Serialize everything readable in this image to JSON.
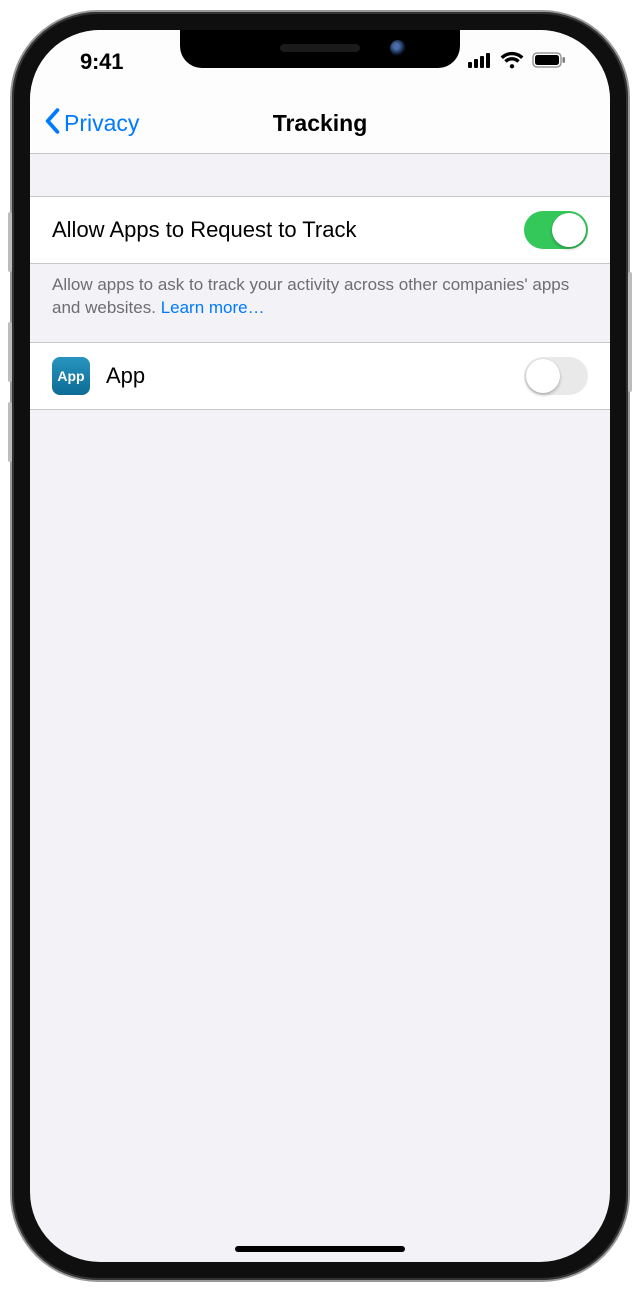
{
  "status": {
    "time": "9:41"
  },
  "nav": {
    "back": "Privacy",
    "title": "Tracking"
  },
  "main": {
    "allow_label": "Allow Apps to Request to Track",
    "allow_on": true,
    "footer": "Allow apps to ask to track your activity across other companies' apps and websites. ",
    "learn_more": "Learn more…"
  },
  "apps": [
    {
      "icon_text": "App",
      "name": "App",
      "on": false
    }
  ]
}
